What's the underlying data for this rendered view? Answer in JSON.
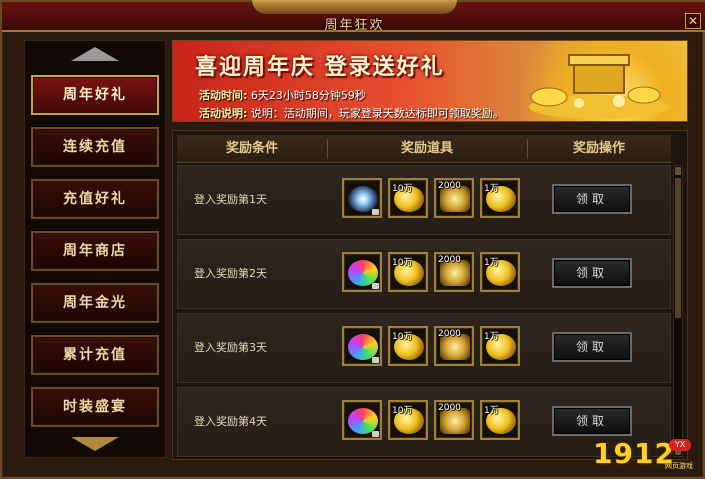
{
  "window": {
    "title": "周年狂欢",
    "close_glyph": "✕"
  },
  "sidebar": {
    "items": [
      {
        "label": "周年好礼",
        "active": true
      },
      {
        "label": "连续充值",
        "active": false
      },
      {
        "label": "充值好礼",
        "active": false
      },
      {
        "label": "周年商店",
        "active": false
      },
      {
        "label": "周年金光",
        "active": false
      },
      {
        "label": "累计充值",
        "active": false
      },
      {
        "label": "时装盛宴",
        "active": false
      }
    ]
  },
  "banner": {
    "heading": "喜迎周年庆 登录送好礼",
    "time_label": "活动时间:",
    "time_value": "6天23小时58分钟59秒",
    "desc_label": "活动说明:",
    "desc_value": "说明：活动期间，玩家登录天数达标即可领取奖励。"
  },
  "table": {
    "headers": [
      "奖励条件",
      "奖励道具",
      "奖励操作"
    ],
    "rows": [
      {
        "condition": "登入奖励第1天",
        "items": [
          {
            "qty": "",
            "icon": "rune-icon"
          },
          {
            "qty": "10万",
            "icon": "gold-ingot-icon"
          },
          {
            "qty": "2000",
            "icon": "gold-scroll-icon"
          },
          {
            "qty": "1万",
            "icon": "gold-coin-icon"
          }
        ],
        "button": "领取"
      },
      {
        "condition": "登入奖励第2天",
        "items": [
          {
            "qty": "",
            "icon": "gem-icon"
          },
          {
            "qty": "10万",
            "icon": "gold-ingot-icon"
          },
          {
            "qty": "2000",
            "icon": "gold-scroll-icon"
          },
          {
            "qty": "1万",
            "icon": "gold-coin-icon"
          }
        ],
        "button": "领取"
      },
      {
        "condition": "登入奖励第3天",
        "items": [
          {
            "qty": "",
            "icon": "gem-icon"
          },
          {
            "qty": "10万",
            "icon": "gold-ingot-icon"
          },
          {
            "qty": "2000",
            "icon": "gold-scroll-icon"
          },
          {
            "qty": "1万",
            "icon": "gold-coin-icon"
          }
        ],
        "button": "领取"
      },
      {
        "condition": "登入奖励第4天",
        "items": [
          {
            "qty": "",
            "icon": "gem-icon"
          },
          {
            "qty": "10万",
            "icon": "gold-ingot-icon"
          },
          {
            "qty": "2000",
            "icon": "gold-scroll-icon"
          },
          {
            "qty": "1万",
            "icon": "gold-coin-icon"
          }
        ],
        "button": "领取"
      }
    ]
  },
  "logo": {
    "number": "1912",
    "badge": "YX",
    "subtitle": "网页游戏"
  },
  "colors": {
    "accent_gold": "#c8a050",
    "active_nav": "#7a1410"
  }
}
